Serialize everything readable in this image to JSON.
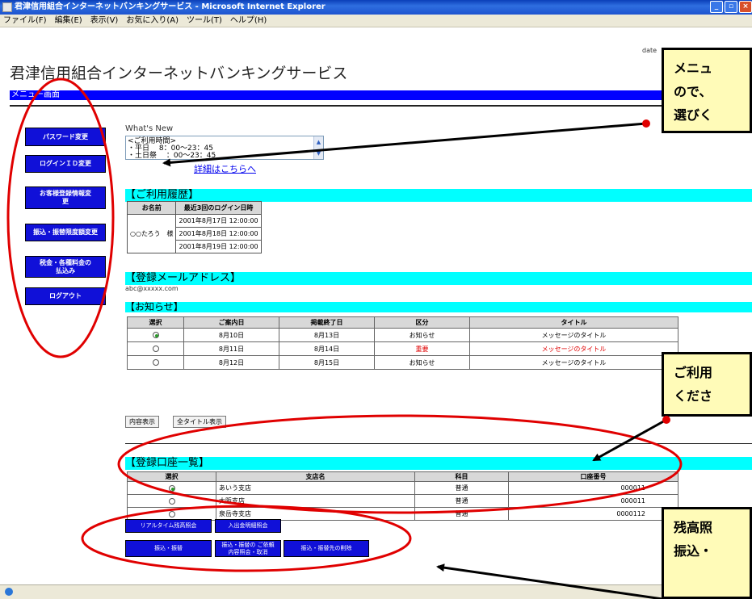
{
  "window": {
    "title": "君津信用組合インターネットバンキングサービス - Microsoft Internet Explorer",
    "menu": [
      "ファイル(F)",
      "編集(E)",
      "表示(V)",
      "お気に入り(A)",
      "ツール(T)",
      "ヘルプ(H)"
    ]
  },
  "page": {
    "date_label": "date",
    "title": "君津信用組合インターネットバンキングサービス",
    "screen_name": "メニュー画面"
  },
  "sidebar": {
    "items": [
      {
        "label": "パスワード変更"
      },
      {
        "label": "ログインＩＤ変更"
      },
      {
        "label": "お客様登録情報変更"
      },
      {
        "label": "振込・振替限度額変更"
      },
      {
        "label": "税金・各種料金の払込み"
      },
      {
        "label": "ログアウト"
      }
    ]
  },
  "whats_new": {
    "label": "What's New",
    "lines": [
      "<ご利用時間>",
      "・平日　 8：00～23：45",
      "・土日祭　 ：00～23：45"
    ],
    "detail_link": "詳細はこちらへ"
  },
  "usage_history": {
    "header": "【ご利用履歴】",
    "col_name": "お名前",
    "col_login": "最近3回のログイン日時",
    "name": "○○たろう　様",
    "logins": [
      "2001年8月17日 12:00:00",
      "2001年8月18日 12:00:00",
      "2001年8月19日 12:00:00"
    ]
  },
  "email": {
    "header": "【登録メールアドレス】",
    "value": "abc@xxxxx.com"
  },
  "notices": {
    "header": "【お知らせ】",
    "columns": [
      "選択",
      "ご案内日",
      "掲載終了日",
      "区分",
      "タイトル"
    ],
    "rows": [
      {
        "selected": true,
        "date": "8月10日",
        "end": "8月13日",
        "category": "お知らせ",
        "title": "メッセージのタイトル",
        "important": false
      },
      {
        "selected": false,
        "date": "8月11日",
        "end": "8月14日",
        "category": "重要",
        "title": "メッセージのタイトル",
        "important": true
      },
      {
        "selected": false,
        "date": "8月12日",
        "end": "8月15日",
        "category": "お知らせ",
        "title": "メッセージのタイトル",
        "important": false
      }
    ],
    "btn_show_content": "内容表示",
    "btn_show_all": "全タイトル表示"
  },
  "accounts": {
    "header": "【登録口座一覧】",
    "columns": [
      "選択",
      "支店名",
      "科目",
      "口座番号"
    ],
    "rows": [
      {
        "selected": true,
        "branch": "あいう支店",
        "type": "普通",
        "number": "000011"
      },
      {
        "selected": false,
        "branch": "大阪支店",
        "type": "普通",
        "number": "000011"
      },
      {
        "selected": false,
        "branch": "泉岳寺支店",
        "type": "普通",
        "number": "0000112"
      }
    ]
  },
  "operations": {
    "realtime_balance": "リアルタイム残高照会",
    "transaction_detail": "入出金明細照会",
    "transfer": "振込・振替",
    "transfer_inquiry": "振込・振替の ご依頼内容照会・取消",
    "delete_payee": "振込・振替先の削除"
  },
  "callouts": {
    "menu_top": [
      "メニュ",
      "ので、",
      "選びく"
    ],
    "account_mid": [
      "ご利用",
      "くださ"
    ],
    "bottom": [
      "残高照",
      "振込・"
    ]
  },
  "colors": {
    "nav_blue": "#1010d8",
    "section_cyan": "#00ffff",
    "highlight_red": "#e00000",
    "callout_yellow": "#fffbb8"
  }
}
